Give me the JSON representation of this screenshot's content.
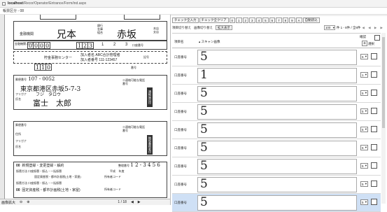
{
  "browser": {
    "url_host": "localhost",
    "url_path": "/Recor/Operator/Entrance/Form/ind.aspx"
  },
  "subbar": {
    "text": "帳票区分 - 08"
  },
  "form": {
    "title_label": "金融機関",
    "bank_name": "兄本",
    "branch_name": "赤坂",
    "bank_kinds": [
      "銀行",
      "金庫",
      "組合"
    ],
    "branch_kinds": [
      "本店",
      "支店"
    ],
    "code_label": "金融機関コード",
    "code_digits": [
      "0",
      "0",
      "0",
      "0"
    ],
    "branch_code_digits": [
      "1",
      "2",
      "3"
    ],
    "deposit_type": [
      "1",
      "2",
      "3"
    ],
    "account_label": "口座番号",
    "center_label": "貯金事務センター",
    "member_label": "加入者名",
    "member_value": "ABC合計管理者",
    "member_no_label": "加入者番号",
    "member_no_value": "111-123457",
    "symbol_digits": [
      "1",
      "1",
      "0"
    ],
    "symbol_label": "記号",
    "number_label": "番号",
    "zip_label": "郵便番号",
    "zip_value": "107 - 0052",
    "address_label": "住所",
    "address_value": "東京都港区赤坂5-7-3",
    "kana_label": "フリガナ",
    "kana_value": "フジ　タロウ",
    "name_label": "氏名",
    "name_value": "富士　太郎",
    "phone_label": "※連絡可能な電話番号",
    "phone_label2": "※連絡可能な電話番号",
    "stamp_label": "通帳届出印",
    "zip_label2": "郵便番号",
    "address_label2": "住所",
    "kana_label2": "フリガナ",
    "name_label2": "氏名",
    "stamp_label2": "納税義務者印",
    "row_a": "00",
    "row_a_text": "新規登録・変更登録・解約",
    "row_a_date_label": "整理番号",
    "row_a_date": "1 2 - 3 4 5 6",
    "row_b_label": "振替方法",
    "row_b_text": "口座振替・振込・一括振替",
    "row_b_year": "平成",
    "row_b_year2": "年度",
    "row_c_text": "固定資産税・都市計画税(土地・家屋)",
    "row_c_owner": "所有者コード",
    "row_d_label": "振替方法",
    "row_d_text": "口座振替・振込・一括振替",
    "row_e": "00",
    "row_e_text": "固定資産税・都市計画税(土地・家屋)",
    "row_e_owner": "所有者コード"
  },
  "left_footer": {
    "zoom": "画像拡大",
    "page": "1 / 18",
    "prev": "◀",
    "next": "▶"
  },
  "toolbar": {
    "buttons": [
      "チェック全入力",
      "チェック全クリア",
      "0",
      "1",
      "2",
      "3",
      "4",
      "5",
      "6",
      "7",
      "8",
      "9",
      "A",
      "自動読込"
    ],
    "row2_label": "項目切り替え",
    "row2_btn1": "画像切り替え",
    "row2_btn2": "拡大表示",
    "page_size": "100",
    "page_info": "件 1 - 8件 / 全8件",
    "nav": "◀ ◀ ▶ ▶"
  },
  "grid_header": {
    "col1": "項目名",
    "col2": "スキャン画像",
    "col3": "確認",
    "col4": "選択",
    "check_label": "未"
  },
  "rows": [
    {
      "label": "口座番号",
      "digit": "5",
      "select": "5"
    },
    {
      "label": "口座番号",
      "digit": "1",
      "select": "1"
    },
    {
      "label": "口座番号",
      "digit": "5",
      "select": "5"
    },
    {
      "label": "口座番号",
      "digit": "5",
      "select": "5"
    },
    {
      "label": "口座番号",
      "digit": "5",
      "select": "5"
    },
    {
      "label": "口座番号",
      "digit": "5",
      "select": "5"
    },
    {
      "label": "口座番号",
      "digit": "5",
      "select": "5"
    },
    {
      "label": "口座番号",
      "digit": "5",
      "select": "5"
    },
    {
      "label": "口座番号",
      "digit": "5",
      "select": "5"
    }
  ]
}
